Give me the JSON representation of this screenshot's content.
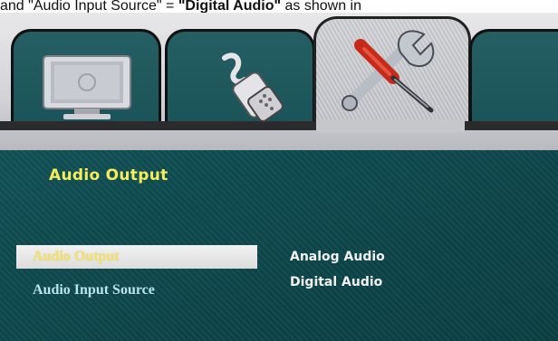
{
  "caption": {
    "prefix": "and \"Audio Input Source\" = ",
    "bold": "\"Digital Audio\"",
    "suffix": " as shown in"
  },
  "tabs": [
    {
      "icon": "tv-icon"
    },
    {
      "icon": "connector-icon"
    },
    {
      "icon": "tools-icon",
      "active": true
    }
  ],
  "section": {
    "title": "Audio Output"
  },
  "menu": {
    "items": [
      {
        "label": "Audio Output",
        "value": "Analog Audio",
        "selected": true
      },
      {
        "label": "Audio Input Source",
        "value": "Digital Audio",
        "selected": false
      }
    ]
  },
  "colors": {
    "background": "#0f4c51",
    "title": "#f4ee5a",
    "selected_text": "#f1e07a",
    "item_text": "#b9e4ee",
    "value_text": "#f2f2f2"
  }
}
